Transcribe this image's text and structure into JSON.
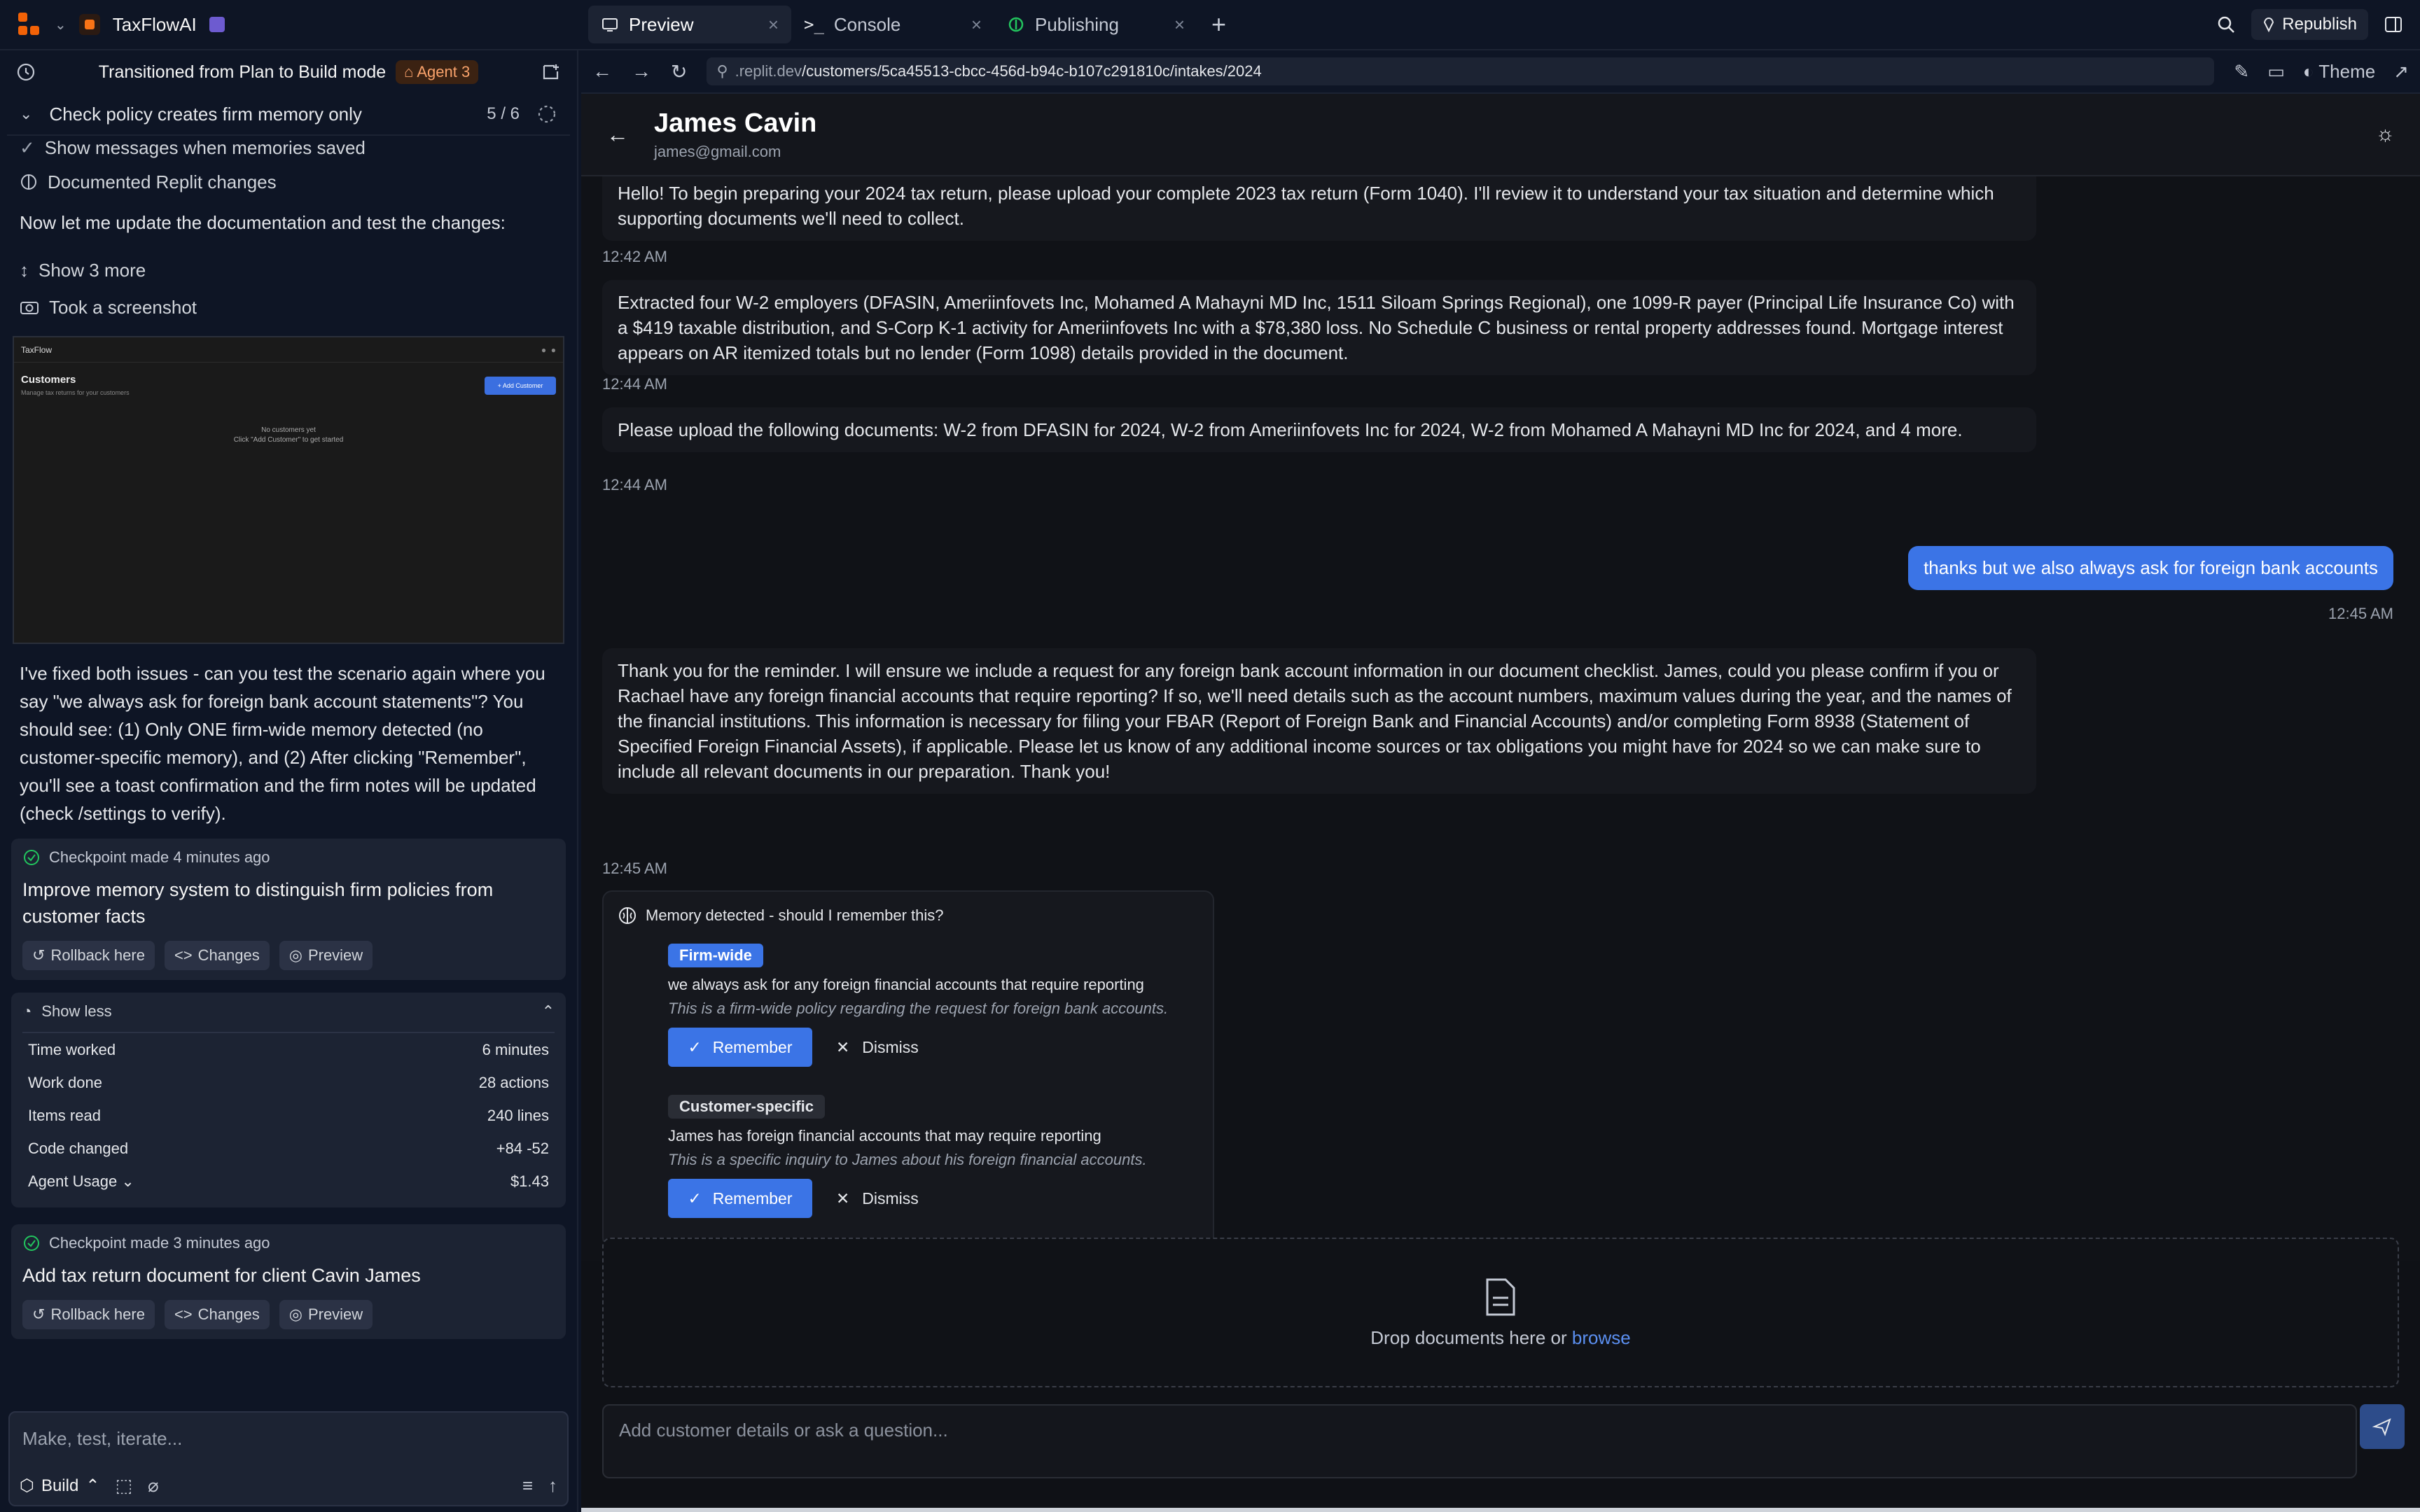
{
  "app": {
    "project_name": "TaxFlowAI"
  },
  "tabs": [
    {
      "label": "Preview",
      "icon": "preview-icon"
    },
    {
      "label": "Console",
      "icon": "terminal-icon"
    },
    {
      "label": "Publishing",
      "icon": "publishing-icon"
    }
  ],
  "topbar": {
    "republish_label": "Republish"
  },
  "left": {
    "header_title": "Transitioned from Plan to Build mode",
    "agent_badge": "Agent 3",
    "task_label": "Check policy creates firm memory only",
    "task_count": "5 / 6",
    "line1": "Show messages when memories saved",
    "line2": "Documented Replit changes",
    "text1": "Now let me update the documentation and test the changes:",
    "show_more": "Show 3 more",
    "screenshot_label": "Took a screenshot",
    "thumb": {
      "brand": "TaxFlow",
      "title": "Customers",
      "subtitle": "Manage tax returns for your customers",
      "button": "+ Add Customer",
      "empty1": "No customers yet",
      "empty2": "Click \"Add Customer\" to get started"
    },
    "summary": "I've fixed both issues - can you test the scenario again where you say \"we always ask for foreign bank account statements\"? You should see: (1) Only ONE firm-wide memory detected (no customer-specific memory), and (2) After clicking \"Remember\", you'll see a toast confirmation and the firm notes will be updated (check /settings to verify).",
    "checkpoint1": {
      "time": "Checkpoint made 4 minutes ago",
      "title": "Improve memory system to distinguish firm policies from customer facts"
    },
    "checkpoint2": {
      "time": "Checkpoint made 3 minutes ago",
      "title": "Add tax return document for client Cavin James"
    },
    "actions": {
      "rollback": "Rollback here",
      "changes": "Changes",
      "preview": "Preview"
    },
    "stats": {
      "toggle": "Show less",
      "rows": [
        {
          "label": "Time worked",
          "value": "6 minutes"
        },
        {
          "label": "Work done",
          "value": "28 actions"
        },
        {
          "label": "Items read",
          "value": "240 lines"
        },
        {
          "label": "Code changed",
          "value": "+84 -52"
        },
        {
          "label": "Agent Usage",
          "value": "$1.43"
        }
      ]
    },
    "composer": {
      "placeholder": "Make, test, iterate...",
      "mode": "Build"
    }
  },
  "right": {
    "url_host": ".replit.dev",
    "url_path": "/customers/5ca45513-cbcc-456d-b94c-b107c291810c/intakes/2024",
    "theme_label": "Theme",
    "customer_name": "James Cavin",
    "customer_email": "james@gmail.com",
    "messages": [
      {
        "text": "Hello! To begin preparing your 2024 tax return, please upload your complete 2023 tax return (Form 1040). I'll review it to understand your tax situation and determine which supporting documents we'll need to collect.",
        "time": "12:42 AM"
      },
      {
        "text": "Extracted four W-2 employers (DFASIN, Ameriinfovets Inc, Mohamed A Mahayni MD Inc, 1511 Siloam Springs Regional), one 1099-R payer (Principal Life Insurance Co) with a $419 taxable distribution, and S-Corp K-1 activity for Ameriinfovets Inc with a $78,380 loss. No Schedule C business or rental property addresses found. Mortgage interest appears on AR itemized totals but no lender (Form 1098) details provided in the document.",
        "time": "12:44 AM"
      },
      {
        "text": "Please upload the following documents: W-2 from DFASIN for 2024, W-2 from Ameriinfovets Inc for 2024, W-2 from Mohamed A Mahayni MD Inc for 2024, and 4 more.",
        "time": "12:44 AM"
      },
      {
        "text": "Thank you for the reminder. I will ensure we include a request for any foreign bank account information in our document checklist. James, could you please confirm if you or Rachael have any foreign financial accounts that require reporting? If so, we'll need details such as the account numbers, maximum values during the year, and the names of the financial institutions. This information is necessary for filing your FBAR (Report of Foreign Bank and Financial Accounts) and/or completing Form 8938 (Statement of Specified Foreign Financial Assets), if applicable. Please let us know of any additional income sources or tax obligations you might have for 2024 so we can make sure to include all relevant documents in our preparation. Thank you!",
        "time": "12:45 AM"
      }
    ],
    "user_message": {
      "text": "thanks but we also always ask for foreign bank accounts",
      "time": "12:45 AM"
    },
    "memory": {
      "title": "Memory detected - should I remember this?",
      "firm": {
        "tag": "Firm-wide",
        "text": "we always ask for any foreign financial accounts that require reporting",
        "note": "This is a firm-wide policy regarding the request for foreign bank accounts."
      },
      "customer": {
        "tag": "Customer-specific",
        "text": "James has foreign financial accounts that may require reporting",
        "note": "This is a specific inquiry to James about his foreign financial accounts."
      },
      "remember": "Remember",
      "dismiss": "Dismiss"
    },
    "drop": {
      "text": "Drop documents here or ",
      "link": "browse"
    },
    "ask_placeholder": "Add customer details or ask a question..."
  }
}
